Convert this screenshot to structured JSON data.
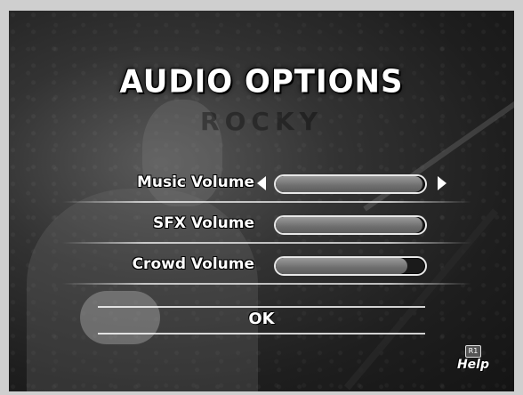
{
  "menu": {
    "title": "AUDIO OPTIONS",
    "background_title_ghost": "ROCKY"
  },
  "settings": [
    {
      "label": "Music Volume",
      "level": 0.98,
      "selected": true
    },
    {
      "label": "SFX Volume",
      "level": 0.98,
      "selected": false
    },
    {
      "label": "Crowd Volume",
      "level": 0.88,
      "selected": false
    }
  ],
  "confirm": {
    "label": "OK"
  },
  "help": {
    "button_icon": "R1",
    "label": "Help"
  }
}
